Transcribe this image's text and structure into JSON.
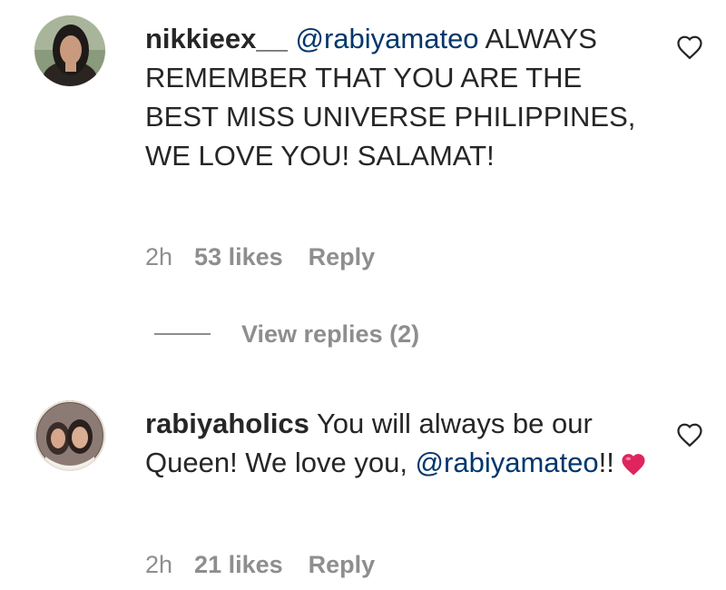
{
  "comments": [
    {
      "username": "nikkieex__",
      "mention": "@rabiyamateo",
      "text_after": " ALWAYS REMEMBER THAT YOU ARE THE BEST MISS UNIVERSE PHILIPPINES, WE LOVE YOU! SALAMAT!",
      "time": "2h",
      "likes": "53 likes",
      "reply_label": "Reply",
      "view_replies": "View replies (2)",
      "avatar_icon": "profile-photo"
    },
    {
      "username": "rabiyaholics",
      "text_before": " You will always be our Queen! We love you, ",
      "mention": "@rabiyamateo",
      "text_after": "!!",
      "emoji": "red-heart",
      "time": "2h",
      "likes": "21 likes",
      "reply_label": "Reply",
      "avatar_icon": "profile-photo"
    }
  ],
  "colors": {
    "text": "#262626",
    "secondary": "#8e8e8e",
    "mention": "#00376b",
    "heart_emoji": "#e0245e"
  },
  "icons": {
    "like": "heart-outline-icon"
  }
}
